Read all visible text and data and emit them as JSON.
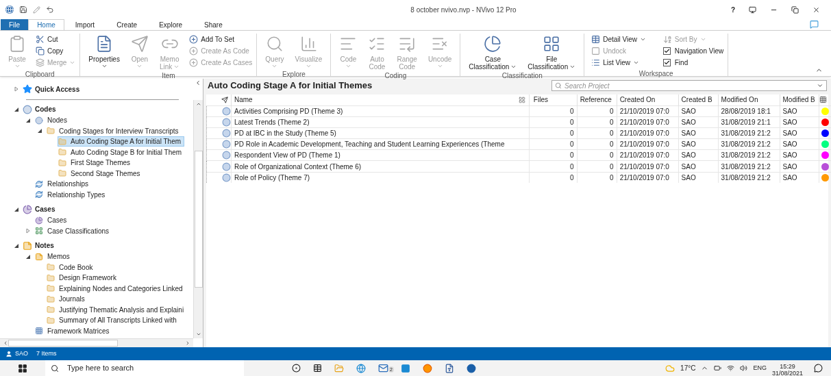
{
  "window": {
    "title": "8 october nvivo.nvp - NVivo 12 Pro",
    "help": "?"
  },
  "ribbon_tabs": [
    {
      "label": "File",
      "kind": "file",
      "selected": false
    },
    {
      "label": "Home",
      "kind": "tab",
      "selected": true
    },
    {
      "label": "Import",
      "kind": "tab",
      "selected": false
    },
    {
      "label": "Create",
      "kind": "tab",
      "selected": false
    },
    {
      "label": "Explore",
      "kind": "tab",
      "selected": false
    },
    {
      "label": "Share",
      "kind": "tab",
      "selected": false
    }
  ],
  "ribbon_groups": [
    {
      "label": "Clipboard",
      "items": [
        {
          "kind": "large",
          "lines": [
            "Paste"
          ],
          "dropdown": true,
          "disabled": true
        },
        {
          "kind": "small",
          "lines": [
            "Cut"
          ],
          "dropdown": false,
          "disabled": false
        },
        {
          "kind": "small",
          "lines": [
            "Copy"
          ],
          "dropdown": false,
          "disabled": false
        },
        {
          "kind": "small",
          "lines": [
            "Merge"
          ],
          "dropdown": true,
          "disabled": true
        }
      ]
    },
    {
      "label": "Item",
      "items": [
        {
          "kind": "large",
          "lines": [
            "Properties"
          ],
          "dropdown": true,
          "disabled": false
        },
        {
          "kind": "large",
          "lines": [
            "Open"
          ],
          "dropdown": true,
          "disabled": true
        },
        {
          "kind": "large",
          "lines": [
            "Memo",
            "Link"
          ],
          "dropdown": true,
          "disabled": true
        },
        {
          "kind": "small",
          "lines": [
            "Add To Set"
          ],
          "dropdown": false,
          "disabled": false
        },
        {
          "kind": "small",
          "lines": [
            "Create As Code"
          ],
          "dropdown": false,
          "disabled": true
        },
        {
          "kind": "small",
          "lines": [
            "Create As Cases"
          ],
          "dropdown": false,
          "disabled": true
        }
      ]
    },
    {
      "label": "Explore",
      "items": [
        {
          "kind": "large",
          "lines": [
            "Query"
          ],
          "dropdown": true,
          "disabled": true
        },
        {
          "kind": "large",
          "lines": [
            "Visualize"
          ],
          "dropdown": true,
          "disabled": true
        }
      ]
    },
    {
      "label": "Coding",
      "items": [
        {
          "kind": "large",
          "lines": [
            "Code"
          ],
          "dropdown": true,
          "disabled": true
        },
        {
          "kind": "large",
          "lines": [
            "Auto",
            "Code"
          ],
          "dropdown": false,
          "disabled": true
        },
        {
          "kind": "large",
          "lines": [
            "Range",
            "Code"
          ],
          "dropdown": false,
          "disabled": true
        },
        {
          "kind": "large",
          "lines": [
            "Uncode"
          ],
          "dropdown": true,
          "disabled": true
        }
      ]
    },
    {
      "label": "Classification",
      "items": [
        {
          "kind": "large",
          "lines": [
            "Case",
            "Classification"
          ],
          "dropdown": true,
          "disabled": false
        },
        {
          "kind": "large",
          "lines": [
            "File",
            "Classification"
          ],
          "dropdown": true,
          "disabled": false
        }
      ]
    },
    {
      "label": "Workspace",
      "items": [
        {
          "kind": "small",
          "lines": [
            "Detail View"
          ],
          "dropdown": true,
          "disabled": false
        },
        {
          "kind": "small",
          "lines": [
            "Undock"
          ],
          "dropdown": false,
          "disabled": true
        },
        {
          "kind": "small",
          "lines": [
            "List View"
          ],
          "dropdown": true,
          "disabled": false
        },
        {
          "kind": "small",
          "lines": [
            "Sort By"
          ],
          "dropdown": true,
          "disabled": true
        },
        {
          "kind": "check",
          "lines": [
            "Navigation View"
          ],
          "checked": true,
          "disabled": false
        },
        {
          "kind": "check",
          "lines": [
            "Find"
          ],
          "checked": true,
          "disabled": false
        }
      ]
    }
  ],
  "navigation": {
    "quick_access": {
      "label": "Quick Access",
      "expanded": false
    },
    "sections": [
      {
        "label": "Codes",
        "kind": "codes",
        "expanded": true,
        "children": [
          {
            "label": "Nodes",
            "kind": "nodes",
            "expanded": true,
            "selected": false,
            "children": [
              {
                "label": "Coding Stages for Interview Transcripts",
                "kind": "folder",
                "expanded": true,
                "selected": false,
                "children": [
                  {
                    "label": "Auto Coding Stage A for Initial Them",
                    "kind": "folder",
                    "selected": true
                  },
                  {
                    "label": "Auto Coding Stage B for Initial Them",
                    "kind": "folder",
                    "selected": false
                  },
                  {
                    "label": "First Stage Themes",
                    "kind": "folder",
                    "selected": false
                  },
                  {
                    "label": "Second Stage Themes",
                    "kind": "folder",
                    "selected": false
                  }
                ]
              }
            ]
          },
          {
            "label": "Relationships",
            "kind": "relationship",
            "selected": false
          },
          {
            "label": "Relationship Types",
            "kind": "relationship",
            "selected": false
          }
        ]
      },
      {
        "label": "Cases",
        "kind": "cases",
        "expanded": true,
        "children": [
          {
            "label": "Cases",
            "kind": "case",
            "selected": false
          },
          {
            "label": "Case Classifications",
            "kind": "classification",
            "expanded": false,
            "selected": false
          }
        ]
      },
      {
        "label": "Notes",
        "kind": "notes",
        "expanded": true,
        "children": [
          {
            "label": "Memos",
            "kind": "memos",
            "expanded": true,
            "selected": false,
            "children": [
              {
                "label": "Code Book",
                "kind": "folder",
                "selected": false
              },
              {
                "label": "Design Framework",
                "kind": "folder",
                "selected": false
              },
              {
                "label": "Explaining Nodes and Categories Linked",
                "kind": "folder",
                "selected": false
              },
              {
                "label": "Journals",
                "kind": "folder",
                "selected": false
              },
              {
                "label": "Justifying Thematic Analysis and Explaini",
                "kind": "folder",
                "selected": false
              },
              {
                "label": "Summary of All Transcripts Linked with",
                "kind": "folder",
                "selected": false
              }
            ]
          },
          {
            "label": "Framework Matrices",
            "kind": "matrix",
            "selected": false
          }
        ]
      }
    ]
  },
  "content": {
    "title": "Auto Coding Stage A for Initial Themes",
    "search": {
      "placeholder": "Search Project"
    },
    "columns": [
      "Name",
      "Files",
      "Reference",
      "Created On",
      "Created B",
      "Modified On",
      "Modified B"
    ],
    "rows": [
      {
        "cells": [
          "Activities Comprising PD (Theme 3)",
          "0",
          "0",
          "21/10/2019 07:0",
          "SAO",
          "28/08/2019 18:1",
          "SAO"
        ],
        "color": "#ffff00"
      },
      {
        "cells": [
          "Latest Trends (Theme 2)",
          "0",
          "0",
          "21/10/2019 07:0",
          "SAO",
          "31/08/2019 21:1",
          "SAO"
        ],
        "color": "#ff0000"
      },
      {
        "cells": [
          "PD at IBC in the Study (Theme 5)",
          "0",
          "0",
          "21/10/2019 07:0",
          "SAO",
          "31/08/2019 21:2",
          "SAO"
        ],
        "color": "#0000ff"
      },
      {
        "cells": [
          "PD Role in Academic Development, Teaching and Student Learning Experiences (Theme",
          "0",
          "0",
          "21/10/2019 07:0",
          "SAO",
          "31/08/2019 21:2",
          "SAO"
        ],
        "color": "#00ff80"
      },
      {
        "cells": [
          "Respondent View of PD (Theme 1)",
          "0",
          "0",
          "21/10/2019 07:0",
          "SAO",
          "31/08/2019 21:2",
          "SAO"
        ],
        "color": "#ff00ff"
      },
      {
        "cells": [
          "Role of Organizational Context (Theme 6)",
          "0",
          "0",
          "21/10/2019 07:0",
          "SAO",
          "31/08/2019 21:2",
          "SAO"
        ],
        "color": "#b84fd8"
      },
      {
        "cells": [
          "Role of Policy (Theme 7)",
          "0",
          "0",
          "21/10/2019 07:0",
          "SAO",
          "31/08/2019 21:2",
          "SAO"
        ],
        "color": "#ff9900"
      }
    ]
  },
  "status_bar": {
    "user": "SAO",
    "items": "7 Items"
  },
  "taskbar": {
    "search": {
      "placeholder": "Type here to search"
    },
    "temperature": "17°C",
    "language": "ENG",
    "time": "15:29",
    "date": "31/08/2021",
    "mail_badge": "2"
  }
}
